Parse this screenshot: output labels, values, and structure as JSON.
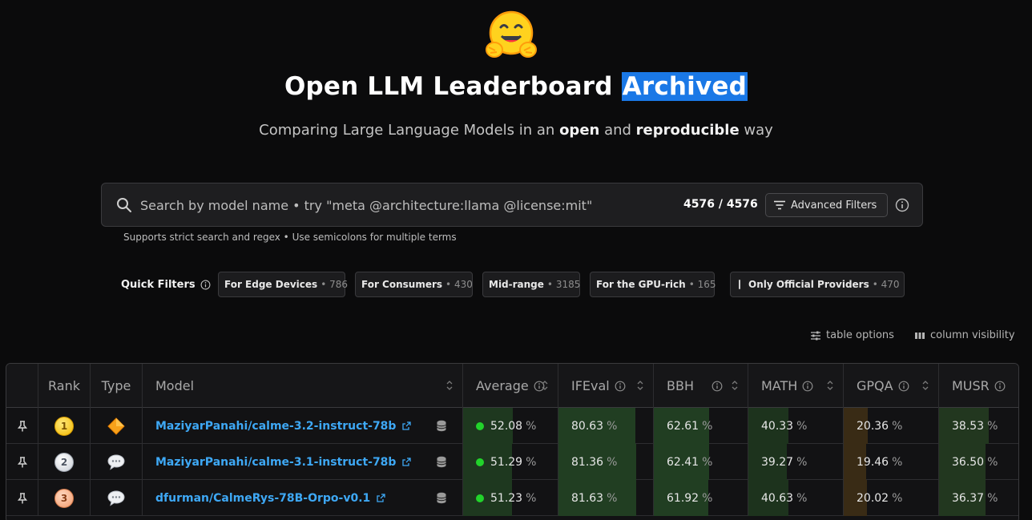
{
  "header": {
    "title_main": "Open LLM Leaderboard",
    "title_highlight": "Archived",
    "subtitle_pre": "Comparing Large Language Models in an ",
    "subtitle_b1": "open",
    "subtitle_mid": " and ",
    "subtitle_b2": "reproducible",
    "subtitle_post": " way",
    "logo_icon": "hugging-face-emoji-icon"
  },
  "search": {
    "placeholder": "Search by model name • try \"meta @architecture:llama @license:mit\"",
    "value": "",
    "count": "4576 / 4576",
    "advanced_label": "Advanced Filters",
    "hint": "Supports strict search and regex • Use semicolons for multiple terms"
  },
  "quick_filters": {
    "label": "Quick Filters",
    "chips": [
      {
        "label": "For Edge Devices",
        "count": "• 786"
      },
      {
        "label": "For Consumers",
        "count": "• 430"
      },
      {
        "label": "Mid-range",
        "count": "• 3185"
      },
      {
        "label": "For the GPU-rich",
        "count": "• 165"
      },
      {
        "label": "Only Official Providers",
        "count": "• 470"
      }
    ]
  },
  "table_options": {
    "options_label": "table options",
    "visibility_label": "column visibility"
  },
  "table": {
    "headers": {
      "rank": "Rank",
      "type": "Type",
      "model": "Model",
      "average": "Average",
      "ifeval": "IFEval",
      "bbh": "BBH",
      "math": "MATH",
      "gpqa": "GPQA",
      "musr": "MUSR"
    },
    "pct_sign": "%",
    "rows": [
      {
        "rank": "1",
        "type_icon": "diamond-icon",
        "model": "MaziyarPanahi/calme-3.2-instruct-78b",
        "average": "52.08",
        "ifeval": "80.63",
        "bbh": "62.61",
        "math": "40.33",
        "gpqa": "20.36",
        "musr": "38.53"
      },
      {
        "rank": "2",
        "type_icon": "chat-bubble-icon",
        "model": "MaziyarPanahi/calme-3.1-instruct-78b",
        "average": "51.29",
        "ifeval": "81.36",
        "bbh": "62.41",
        "math": "39.27",
        "gpqa": "19.46",
        "musr": "36.50"
      },
      {
        "rank": "3",
        "type_icon": "chat-bubble-icon",
        "model": "dfurman/CalmeRys-78B-Orpo-v0.1",
        "average": "51.23",
        "ifeval": "81.63",
        "bbh": "61.92",
        "math": "40.63",
        "gpqa": "20.02",
        "musr": "36.37"
      }
    ]
  },
  "colors": {
    "accent_blue": "#3ea8f5",
    "highlight_blue": "#1a78e6",
    "status_green": "#22d32b",
    "score_green": "#1f3a1f",
    "score_amber": "#3a2d17"
  }
}
